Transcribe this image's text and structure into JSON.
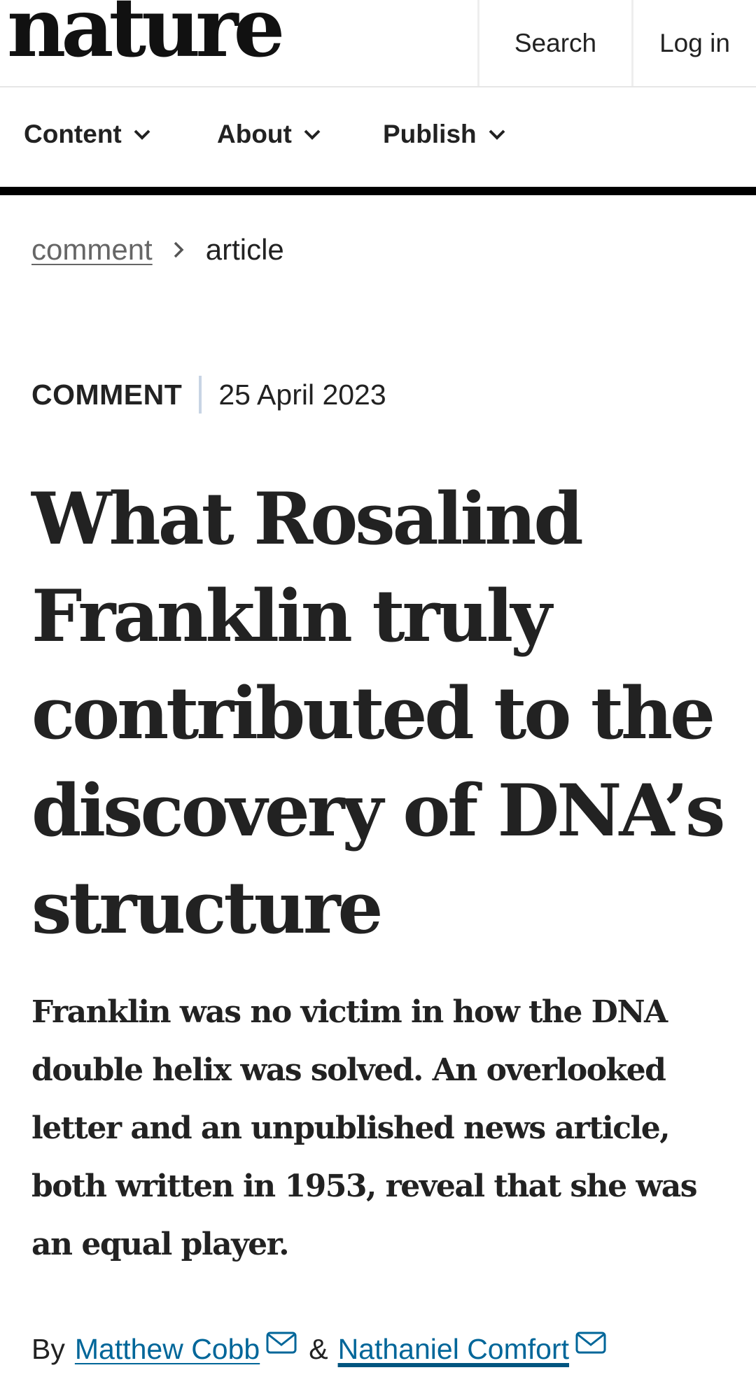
{
  "header": {
    "logo": "nature",
    "search_label": "Search",
    "login_label": "Log in"
  },
  "nav": {
    "items": [
      {
        "label": "Content",
        "icon": "chevron-down-icon"
      },
      {
        "label": "About",
        "icon": "chevron-down-icon"
      },
      {
        "label": "Publish",
        "icon": "chevron-down-icon"
      }
    ]
  },
  "breadcrumb": {
    "parent": "comment",
    "separator_icon": "chevron-right-icon",
    "current": "article"
  },
  "article": {
    "type": "COMMENT",
    "date": "25 April 2023",
    "title": "What Rosalind Franklin truly contributed to the discovery of DNA’s structure",
    "standfirst": "Franklin was no victim in how the DNA double helix was solved. An overlooked letter and an unpublished news article, both written in 1953, reveal that she was an equal player.",
    "by_label": "By",
    "authors": [
      {
        "name": "Matthew Cobb",
        "icon": "mail-icon"
      },
      {
        "name": "Nathaniel Comfort",
        "icon": "mail-icon"
      }
    ],
    "author_separator": "&"
  },
  "colors": {
    "link": "#006699",
    "text": "#222222",
    "divider": "#c8d4e4",
    "nav_border": "#000000"
  }
}
